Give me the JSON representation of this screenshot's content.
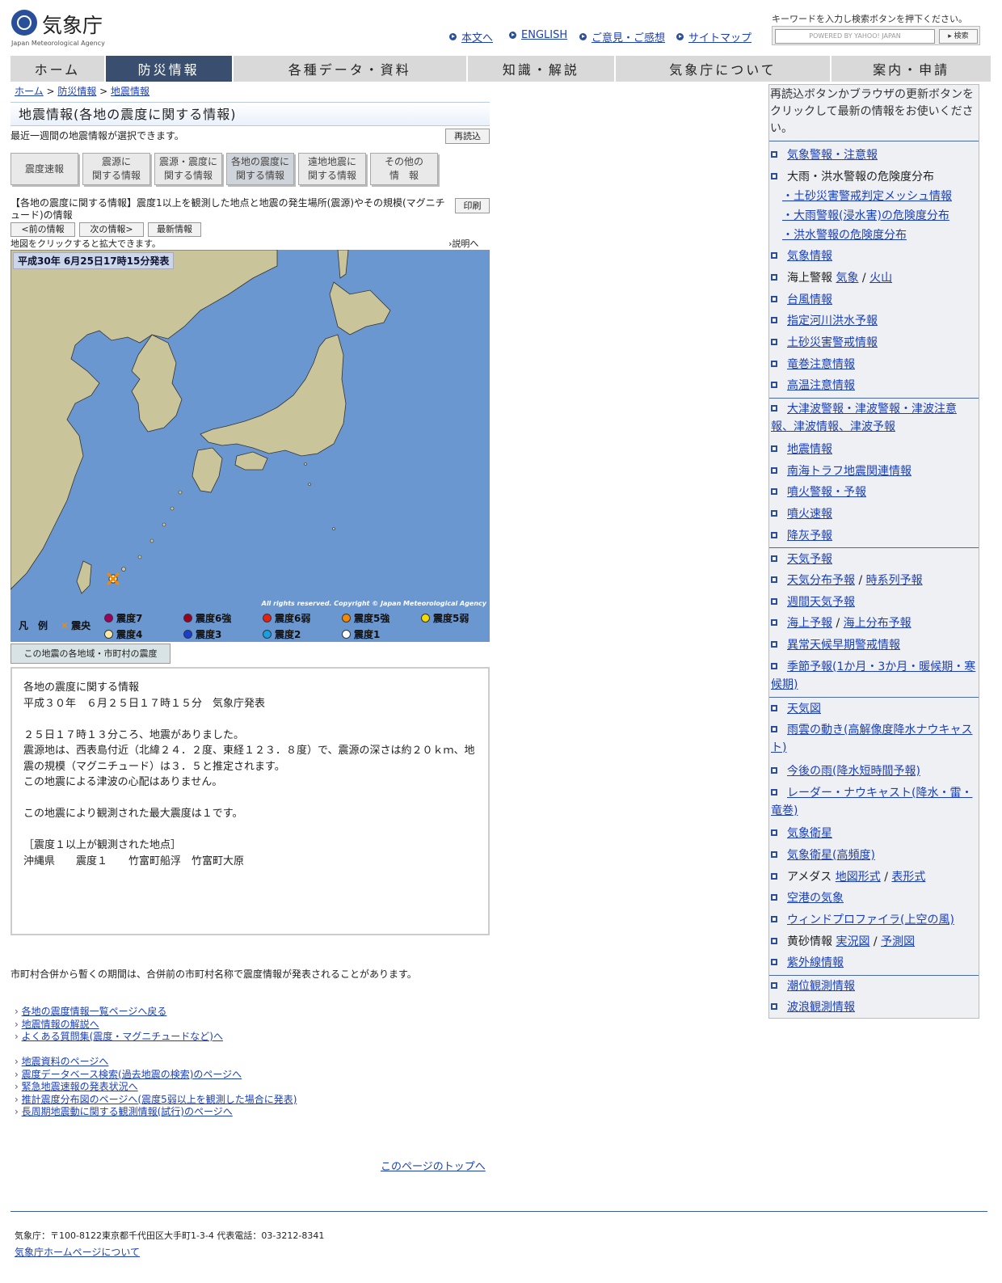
{
  "header": {
    "logo_text": "気象庁",
    "logo_sub": "Japan Meteorological Agency",
    "links": [
      "本文へ",
      "ENGLISH",
      "ご意見・ご感想",
      "サイトマップ"
    ],
    "search_note": "キーワードを入力し検索ボタンを押下ください。",
    "search_placeholder": "POWERED BY YAHOO! JAPAN",
    "search_button": "▸ 検索"
  },
  "nav": [
    "ホーム",
    "防災情報",
    "各種データ・資料",
    "知識・解説",
    "気象庁について",
    "案内・申請"
  ],
  "breadcrumb": [
    "ホーム",
    "防災情報",
    "地震情報"
  ],
  "page": {
    "title": "地震情報(各地の震度に関する情報)",
    "subtitle": "最近一週間の地震情報が選択できます。",
    "reload": "再読込",
    "tabs": [
      "震度速報",
      "震源に\n関する情報",
      "震源・震度に\n関する情報",
      "各地の震度に\n関する情報",
      "遠地地震に\n関する情報",
      "その他の\n情　報"
    ],
    "desc": "【各地の震度に関する情報】震度1以上を観測した地点と地震の発生場所(震源)やその規模(マグニチュード)の情報",
    "print": "印刷",
    "prev": "<前の情報",
    "next": "次の情報>",
    "latest": "最新情報",
    "map_hint": "地図をクリックすると拡大できます。",
    "explain": "›説明へ",
    "map_date": "平成30年 6月25日17時15分発表",
    "map_copy": "All rights reserved. Copyright © Japan Meteorological Agency",
    "muni_tab": "この地震の各地域・市町村の震度"
  },
  "legend": {
    "label": "凡　例",
    "epicenter": "震央",
    "items": [
      {
        "label": "震度7",
        "color": "#a0005a"
      },
      {
        "label": "震度6強",
        "color": "#9b0020"
      },
      {
        "label": "震度6弱",
        "color": "#e8200e"
      },
      {
        "label": "震度5強",
        "color": "#f58a00"
      },
      {
        "label": "震度5弱",
        "color": "#f5d800"
      },
      {
        "label": "震度4",
        "color": "#fbe9a8"
      },
      {
        "label": "震度3",
        "color": "#1a3fcf"
      },
      {
        "label": "震度2",
        "color": "#1aa0e0"
      },
      {
        "label": "震度1",
        "color": "#ffffff"
      }
    ]
  },
  "info_text": "各地の震度に関する情報\n平成３０年　６月２５日１７時１５分　気象庁発表\n\n２５日１７時１３分ころ、地震がありました。\n震源地は、西表島付近（北緯２４．２度、東経１２３．８度）で、震源の深さは約２０ｋｍ、地震の規模（マグニチュード）は３．５と推定されます。\nこの地震による津波の心配はありません。\n\nこの地震により観測された最大震度は１です。\n\n［震度１以上が観測された地点］\n沖縄県　　震度１　　竹富町船浮　竹富町大原",
  "merge_note": "市町村合併から暫くの期間は、合併前の市町村名称で震度情報が発表されることがあります。",
  "links1": [
    "各地の震度情報一覧ページへ戻る",
    "地震情報の解説へ",
    "よくある質問集(震度・マグニチュードなど)へ"
  ],
  "links2": [
    "地震資料のページへ",
    "震度データベース検索(過去地震の検索)のページへ",
    "緊急地震速報の発表状況へ",
    "推計震度分布図のページへ(震度5弱以上を観測した場合に発表)",
    "長周期地震動に関する観測情報(試行)のページへ"
  ],
  "pagetop": "このページのトップへ",
  "footer": {
    "address": "気象庁：〒100-8122東京都千代田区大手町1-3-4 代表電話：03-3212-8341",
    "about": "気象庁ホームページについて"
  },
  "sidebar": {
    "note": "再読込ボタンかブラウザの更新ボタンをクリックして最新の情報をお使いください。",
    "items": [
      {
        "t": "気象警報・注意報",
        "link": true
      },
      {
        "t": "大雨・洪水警報の危険度分布",
        "link": false
      },
      {
        "t": "・土砂災害警戒判定メッシュ情報",
        "link": true,
        "sub": true
      },
      {
        "t": "・大雨警報(浸水害)の危険度分布",
        "link": true,
        "sub": true
      },
      {
        "t": "・洪水警報の危険度分布",
        "link": true,
        "sub": true
      },
      {
        "t": "気象情報",
        "link": true
      },
      {
        "t": "海上警報",
        "parts": [
          "気象",
          "火山"
        ]
      },
      {
        "t": "台風情報",
        "link": true
      },
      {
        "t": "指定河川洪水予報",
        "link": true
      },
      {
        "t": "土砂災害警戒情報",
        "link": true
      },
      {
        "t": "竜巻注意情報",
        "link": true
      },
      {
        "t": "高温注意情報",
        "link": true
      },
      {
        "t": "大津波警報・津波警報・津波注意報、津波情報、津波予報",
        "link": true
      },
      {
        "t": "地震情報",
        "link": true
      },
      {
        "t": "南海トラフ地震関連情報",
        "link": true
      },
      {
        "t": "噴火警報・予報",
        "link": true
      },
      {
        "t": "噴火速報",
        "link": true
      },
      {
        "t": "降灰予報",
        "link": true
      },
      {
        "t": "天気予報",
        "link": true
      },
      {
        "t": "天気分布予報",
        "parts2": "時系列予報"
      },
      {
        "t": "週間天気予報",
        "link": true
      },
      {
        "t": "海上予報",
        "parts2": "海上分布予報"
      },
      {
        "t": "異常天候早期警戒情報",
        "link": true
      },
      {
        "t": "季節予報(1か月・3か月・暖候期・寒候期)",
        "link": true
      },
      {
        "t": "天気図",
        "link": true
      },
      {
        "t": "雨雲の動き(高解像度降水ナウキャスト)",
        "link": true
      },
      {
        "t": "今後の雨(降水短時間予報)",
        "link": true
      },
      {
        "t": "レーダー・ナウキャスト(降水・雷・竜巻)",
        "link": true
      },
      {
        "t": "気象衛星",
        "link": true
      },
      {
        "t": "気象衛星(高頻度)",
        "link": true
      },
      {
        "t": "アメダス",
        "parts": [
          "地図形式",
          "表形式"
        ]
      },
      {
        "t": "空港の気象",
        "link": true
      },
      {
        "t": "ウィンドプロファイラ(上空の風)",
        "link": true
      },
      {
        "t": "黄砂情報",
        "parts": [
          "実況図",
          "予測図"
        ]
      },
      {
        "t": "紫外線情報",
        "link": true
      },
      {
        "t": "潮位観測情報",
        "link": true
      },
      {
        "t": "波浪観測情報",
        "link": true
      }
    ]
  }
}
